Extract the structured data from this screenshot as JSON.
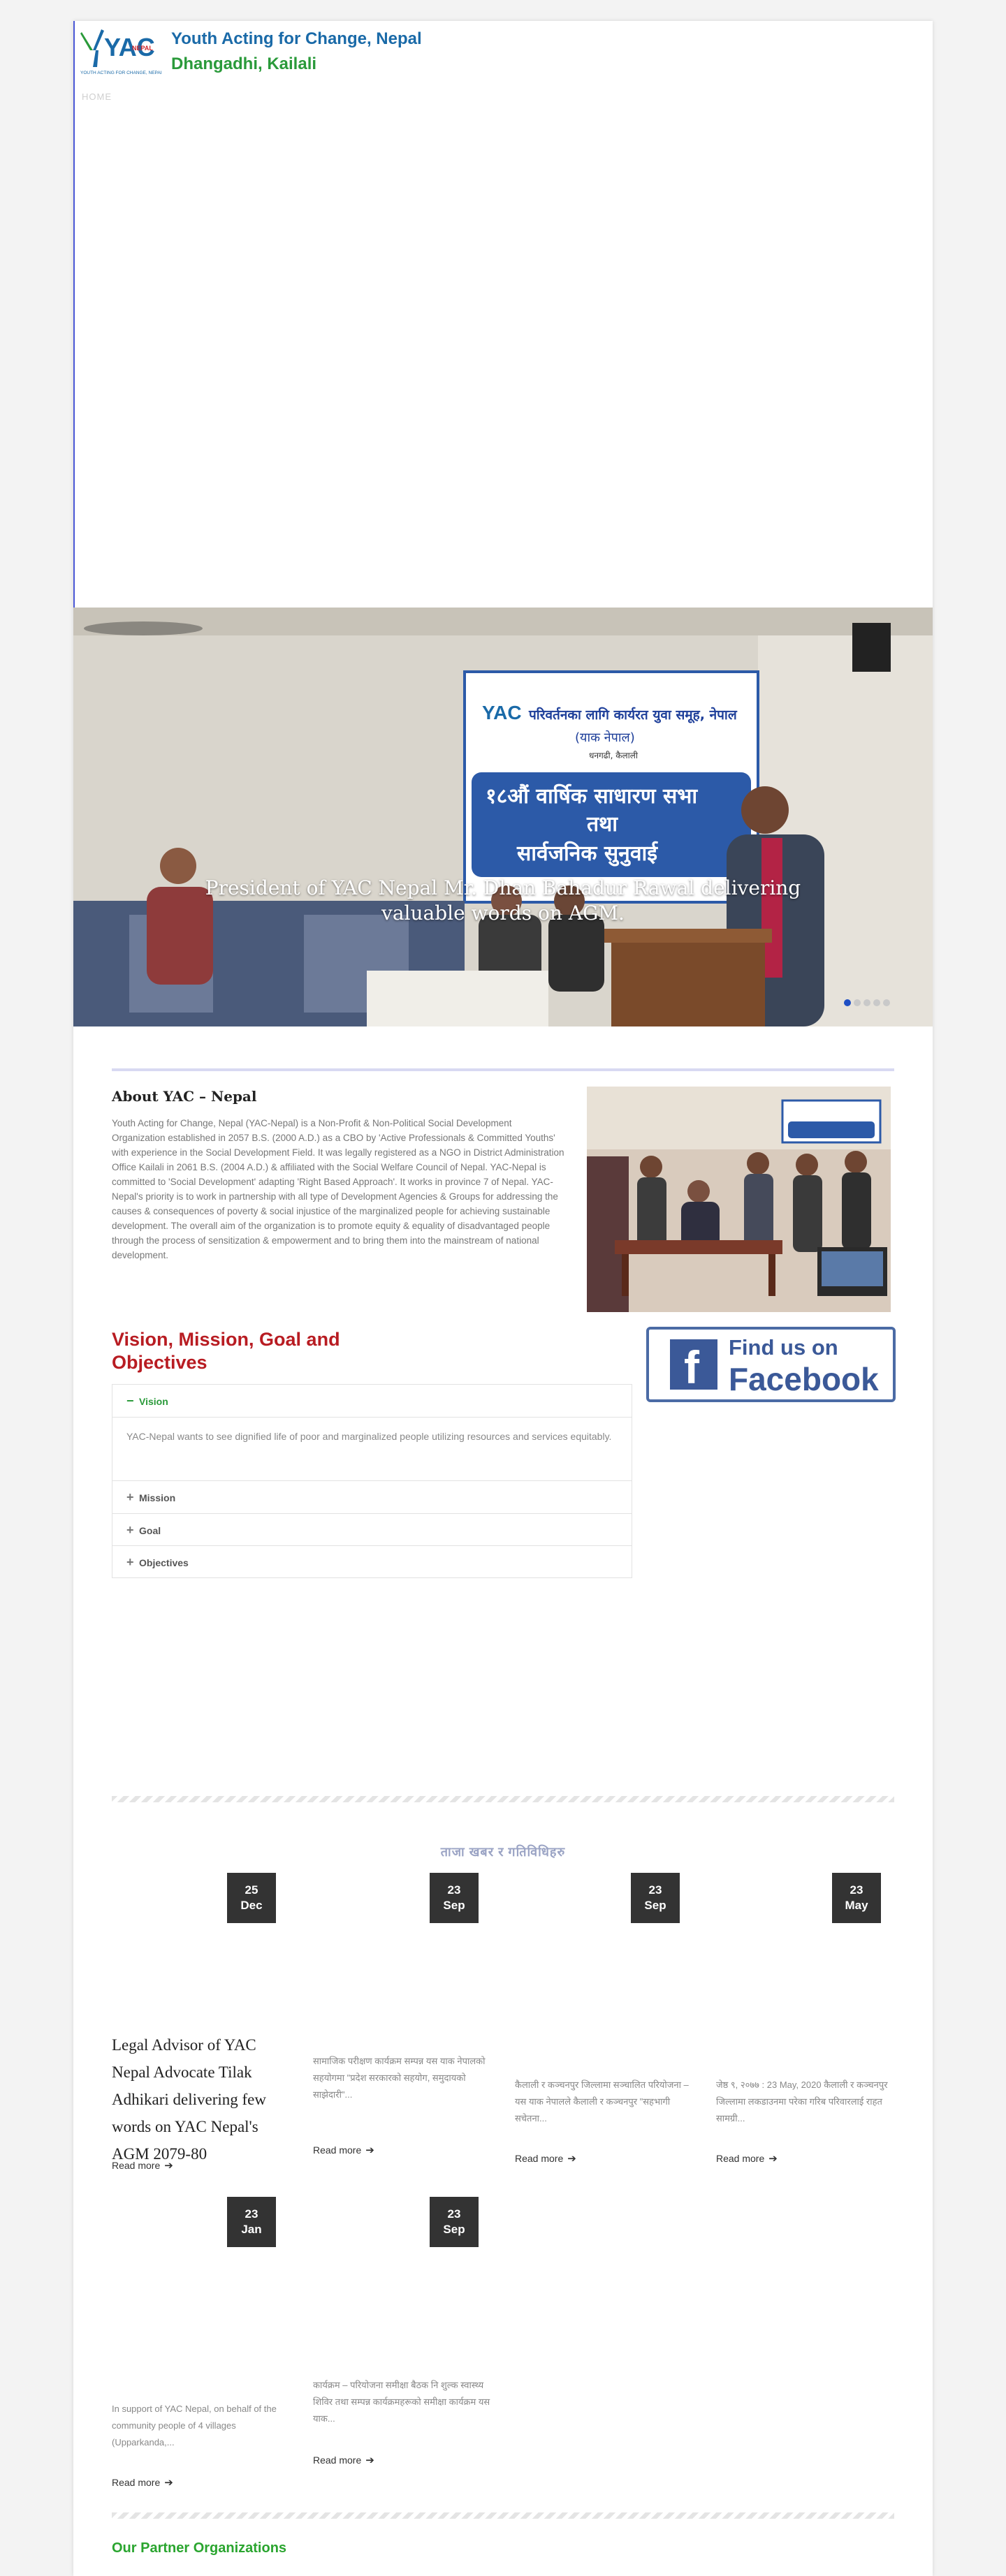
{
  "header": {
    "title": "Youth Acting for Change, Nepal",
    "subtitle": "Dhangadhi, Kailali",
    "logo_text": "YAC",
    "logo_badge": "NEPAL",
    "logo_tagline": "YOUTH ACTING FOR CHANGE, NEPAL",
    "nav_home": "HOME"
  },
  "slider": {
    "caption": "President of YAC Nepal Mr. Dhan Bahadur Rawal delivering valuable words on AGM.",
    "banner_line1": "परिवर्तनका लागि कार्यरत युवा समूह, नेपाल",
    "banner_line2": "(याक नेपाल)",
    "banner_line3": "धनगढी, कैलाली",
    "banner_line4": "१८औं वार्षिक साधारण सभा",
    "banner_line5": "तथा",
    "banner_line6": "सार्वजनिक सुनुवाई",
    "dots_count": 5,
    "active_dot": 0
  },
  "about": {
    "title": "About YAC – Nepal",
    "text": "Youth Acting for Change, Nepal (YAC-Nepal) is a Non-Profit & Non-Political Social Development Organization established in 2057 B.S. (2000 A.D.) as a CBO by 'Active Professionals & Committed Youths' with experience in the Social Development Field. It was legally registered as a NGO in District Administration Office Kailali in 2061 B.S. (2004 A.D.) & affiliated with the Social Welfare Council of Nepal. YAC-Nepal is committed to 'Social Development' adapting 'Right Based Approach'. It works in province 7 of Nepal. YAC-Nepal's priority is to work in partnership with all type of Development Agencies & Groups for addressing the causes & consequences of poverty & social injustice of the marginalized people for achieving sustainable development. The overall aim of the organization is to promote equity & equality of disadvantaged people through the process of sensitization & empowerment and to bring them into the mainstream of national development."
  },
  "vision_section": {
    "title": "Vision, Mission, Goal and Objectives",
    "items": [
      {
        "label": "Vision",
        "open": true,
        "symbol": "−",
        "body": "YAC-Nepal wants to see dignified life of poor and marginalized people utilizing resources and services equitably."
      },
      {
        "label": "Mission",
        "open": false,
        "symbol": "+"
      },
      {
        "label": "Goal",
        "open": false,
        "symbol": "+"
      },
      {
        "label": "Objectives",
        "open": false,
        "symbol": "+"
      }
    ]
  },
  "facebook": {
    "line1": "Find us on",
    "line2": "Facebook"
  },
  "news": {
    "heading": "ताजा खबर र गतिविधिहरु",
    "items": [
      {
        "day": "25",
        "month": "Dec",
        "title": "Legal Advisor of YAC Nepal Advocate Tilak Adhikari delivering few words on YAC Nepal's AGM 2079-80",
        "excerpt": "",
        "read_more": "Read more"
      },
      {
        "day": "23",
        "month": "Sep",
        "title": "",
        "excerpt": "सामाजिक परीक्षण कार्यक्रम सम्पन्न यस याक नेपालको सहयोगमा \"प्रदेश सरकारको सहयोग, समुदायको साझेदारी\"...",
        "read_more": "Read more"
      },
      {
        "day": "23",
        "month": "Sep",
        "title": "",
        "excerpt": "कैलाली र कञ्चनपुर जिल्लामा सञ्चालित परियोजना – यस याक नेपालले कैलाली र कञ्चनपुर \"सहभागी सचेतना...",
        "read_more": "Read more"
      },
      {
        "day": "23",
        "month": "May",
        "title": "",
        "excerpt": "जेष्ठ ९, २०७७ : 23 May, 2020 कैलाली र कञ्चनपुर जिल्लामा लकडाउनमा परेका गरिब परिवारलाई राहत सामग्री...",
        "read_more": "Read more"
      },
      {
        "day": "23",
        "month": "Jan",
        "title": "",
        "excerpt": "In support of YAC Nepal, on behalf of the community people of 4 villages (Upparkanda,...",
        "read_more": "Read more"
      },
      {
        "day": "23",
        "month": "Sep",
        "title": "",
        "excerpt": "कार्यक्रम – परियोजना समीक्षा बैठक नि शुल्क स्वास्थ्य शिविर तथा सम्पन्न कार्यक्रमहरूको समीक्षा कार्यक्रम यस याक...",
        "read_more": "Read more"
      }
    ]
  },
  "partners": {
    "title": "Our Partner Organizations"
  },
  "colors": {
    "title_blue": "#1a6aa8",
    "green": "#2a9a3a",
    "vision_red": "#b81c22",
    "date_badge": "#333333",
    "facebook_blue": "#3b5998",
    "active_dot": "#1f4fc4"
  }
}
